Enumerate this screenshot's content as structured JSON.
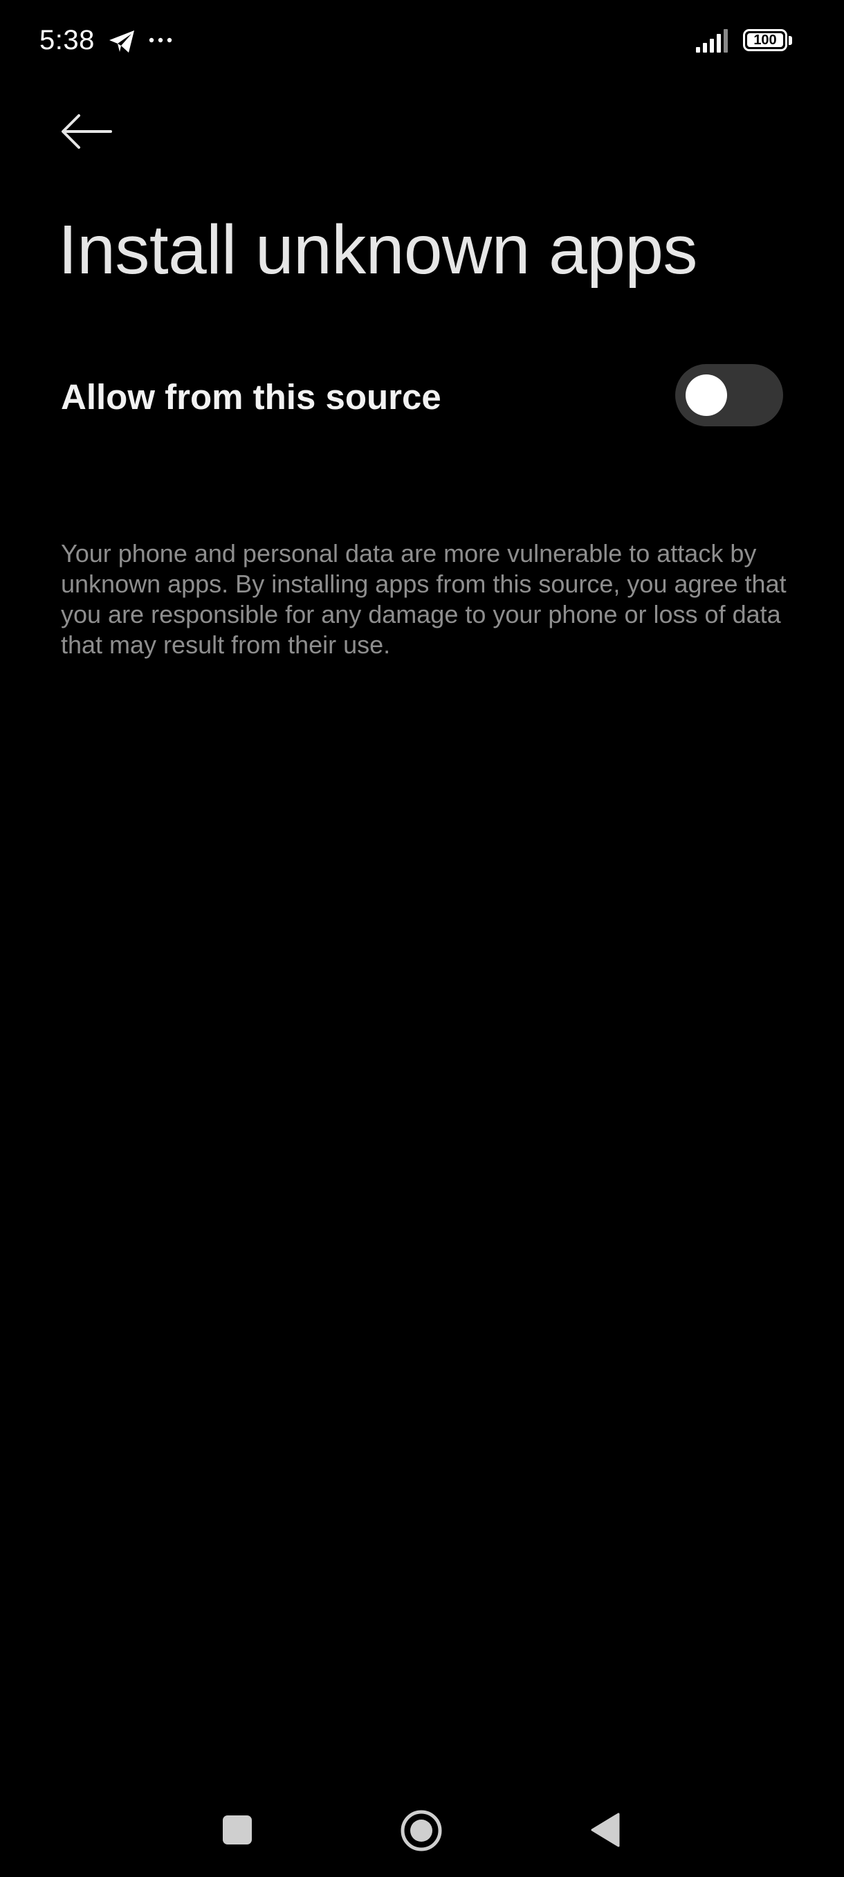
{
  "status_bar": {
    "time": "5:38",
    "battery_level": "100",
    "icons": [
      "telegram-icon",
      "more-dots-icon",
      "signal-icon",
      "battery-icon"
    ]
  },
  "header": {
    "back_icon": "arrow-left-icon",
    "title": "Install unknown apps"
  },
  "setting": {
    "label": "Allow from this source",
    "enabled": false
  },
  "warning": {
    "text": "Your phone and personal data are more vulnerable to attack by unknown apps. By installing apps from this source, you agree that you are responsible for any damage to your phone or loss of data that may result from their use."
  },
  "navigation": {
    "buttons": [
      "recent-apps-icon",
      "home-icon",
      "back-triangle-icon"
    ]
  },
  "colors": {
    "background": "#000000",
    "title": "#e6e6e6",
    "label": "#f2f2f2",
    "secondary_text": "#8e8e8e",
    "toggle_track_off": "#353535",
    "toggle_knob": "#ffffff"
  }
}
